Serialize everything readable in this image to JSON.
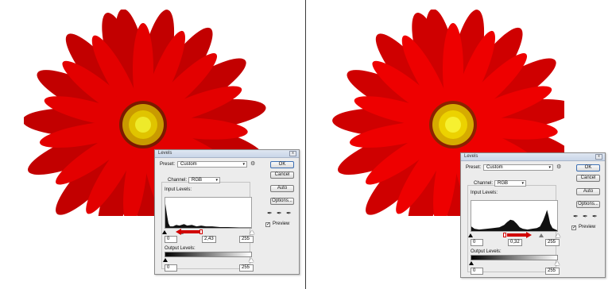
{
  "dialog_left": {
    "title": "Levels",
    "close_label": "x",
    "preset_label": "Preset:",
    "preset_value": "Custom",
    "channel_label": "Channel:",
    "channel_value": "RGB",
    "input_levels_label": "Input Levels:",
    "input_black": "0",
    "input_gamma": "2,43",
    "input_white": "255",
    "output_levels_label": "Output Levels:",
    "output_black": "0",
    "output_white": "255",
    "buttons": {
      "ok": "OK",
      "cancel": "Cancel",
      "auto": "Auto",
      "options": "Options..."
    },
    "preview_label": "Preview",
    "preview_checked": true
  },
  "dialog_right": {
    "title": "Levels",
    "close_label": "x",
    "preset_label": "Preset:",
    "preset_value": "Custom",
    "channel_label": "Channel:",
    "channel_value": "RGB",
    "input_levels_label": "Input Levels:",
    "input_black": "0",
    "input_gamma": "0,32",
    "input_white": "255",
    "output_levels_label": "Output Levels:",
    "output_black": "0",
    "output_white": "255",
    "buttons": {
      "ok": "OK",
      "cancel": "Cancel",
      "auto": "Auto",
      "options": "Options..."
    },
    "preview_label": "Preview",
    "preview_checked": true
  },
  "colors": {
    "petal_left": "#cc0000",
    "petal_right": "#d80000",
    "center": "#e5c200",
    "stamen": "#f2e300",
    "arrow": "#d10000"
  }
}
